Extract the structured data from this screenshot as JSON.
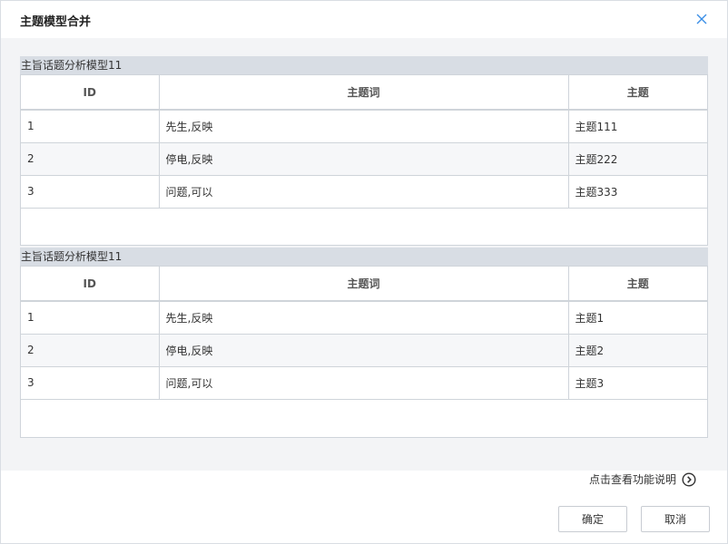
{
  "dialog": {
    "title": "主题模型合并",
    "close_icon": "close-icon"
  },
  "tables": [
    {
      "title": "主旨话题分析模型11",
      "headers": [
        "ID",
        "主题词",
        "主题"
      ],
      "rows": [
        [
          "1",
          "先生,反映",
          "主题111"
        ],
        [
          "2",
          "停电,反映",
          "主题222"
        ],
        [
          "3",
          "问题,可以",
          "主题333"
        ]
      ]
    },
    {
      "title": "主旨话题分析模型11",
      "headers": [
        "ID",
        "主题词",
        "主题"
      ],
      "rows": [
        [
          "1",
          "先生,反映",
          "主题1"
        ],
        [
          "2",
          "停电,反映",
          "主题2"
        ],
        [
          "3",
          "问题,可以",
          "主题3"
        ]
      ]
    }
  ],
  "footer": {
    "help_text": "点击查看功能说明",
    "help_icon": "chevron-right-circle-icon",
    "ok_label": "确定",
    "cancel_label": "取消"
  },
  "colors": {
    "section_header_bg": "#d8dde4",
    "body_bg": "#f3f4f6",
    "close_icon": "#3a8ee6"
  }
}
